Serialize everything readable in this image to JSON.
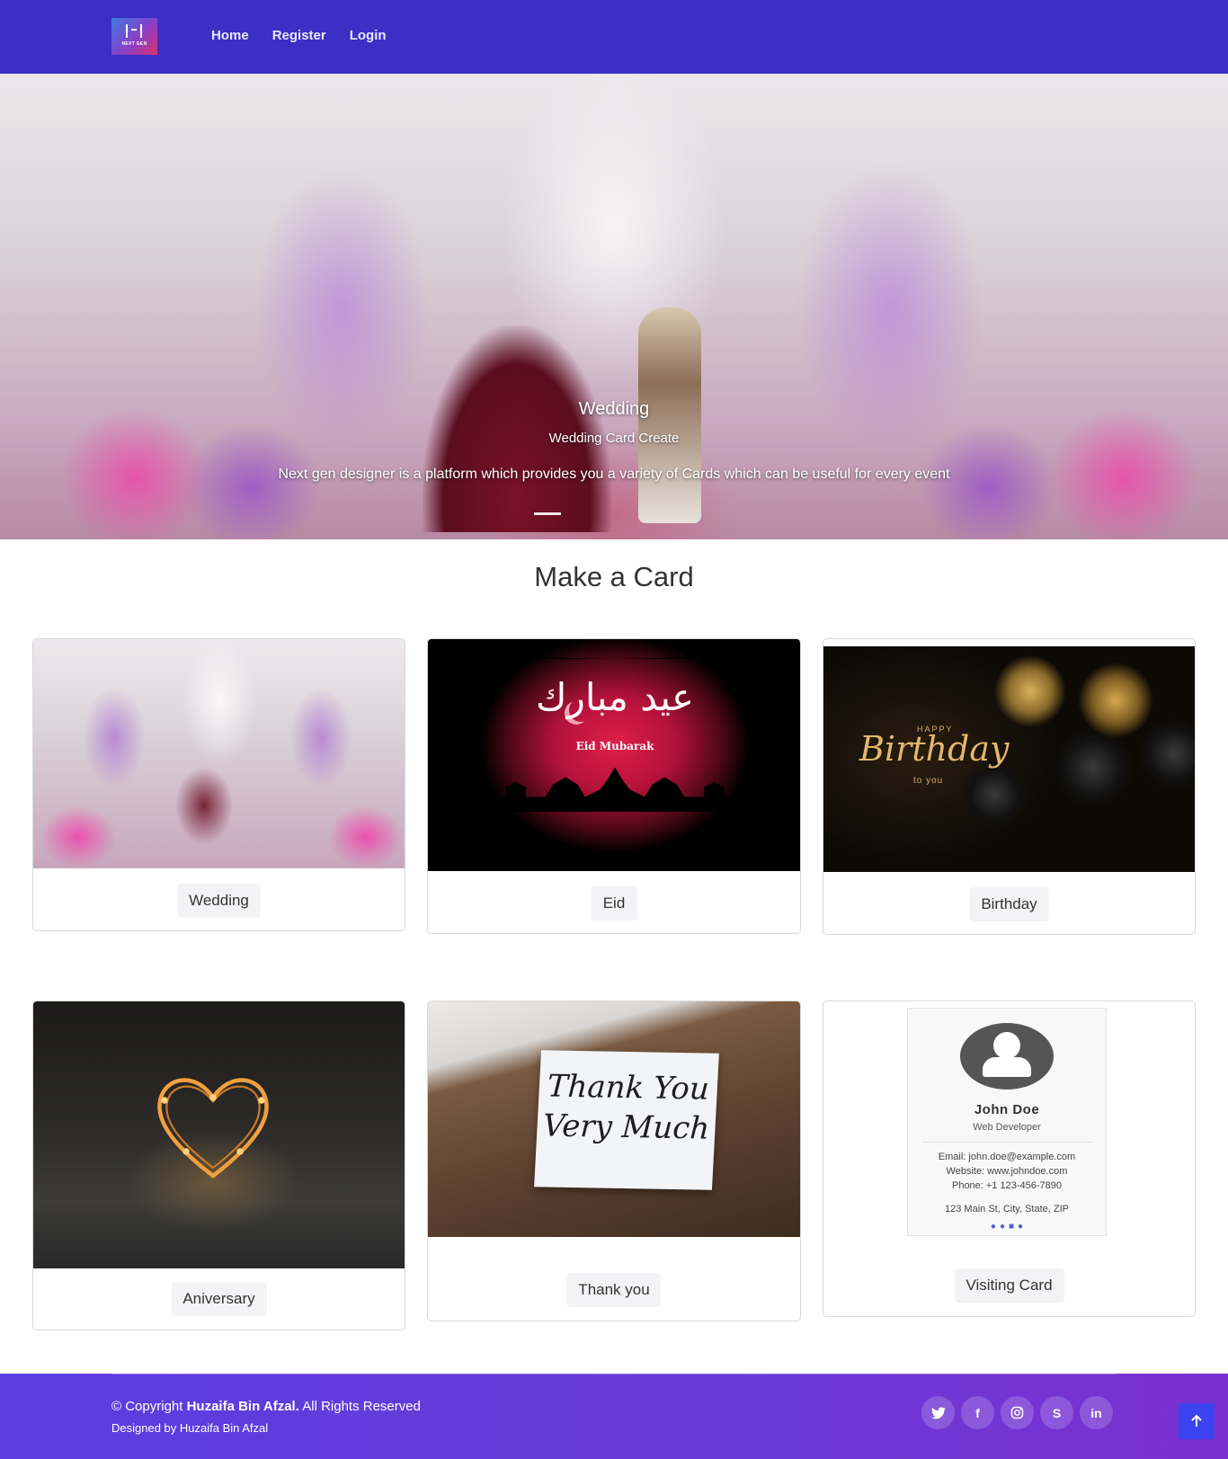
{
  "header": {
    "logo_text": "NEXT GEN",
    "nav": [
      "Home",
      "Register",
      "Login"
    ]
  },
  "hero": {
    "title": "Wedding",
    "subtitle": "Wedding Card Create",
    "text": "Next gen designer is a platform which provides you a variety of Cards which can be useful for every event"
  },
  "section": {
    "title": "Make a Card"
  },
  "cards": [
    {
      "label": "Wedding",
      "image": "wedding-photo"
    },
    {
      "label": "Eid",
      "image": "eid-mubarak-art",
      "image_text": "Eid Mubarak",
      "image_script": "عيد مبارك"
    },
    {
      "label": "Birthday",
      "image": "birthday-balloons",
      "image_small": "HAPPY",
      "image_main": "Birthday",
      "image_to": "to you"
    },
    {
      "label": "Aniversary",
      "image": "heart-lights"
    },
    {
      "label": "Thank you",
      "image": "thank-you-note",
      "image_text_1": "Thank You",
      "image_text_2": "Very Much"
    },
    {
      "label": "Visiting Card",
      "image": "visiting-card-sample"
    }
  ],
  "visiting_card": {
    "name": "John Doe",
    "role": "Web Developer",
    "email": "Email: john.doe@example.com",
    "website": "Website: www.johndoe.com",
    "phone": "Phone: +1 123-456-7890",
    "address": "123 Main St, City, State, ZIP"
  },
  "footer": {
    "copyright_prefix": "© Copyright",
    "copyright_name": "Huzaifa Bin Afzal.",
    "copyright_suffix": "All Rights Reserved",
    "designed_by": "Designed by Huzaifa Bin Afzal",
    "socials": [
      "twitter-icon",
      "facebook-icon",
      "instagram-icon",
      "skype-icon",
      "linkedin-icon"
    ]
  },
  "colors": {
    "header": "#3b2fc6",
    "footer": "#5b3de0",
    "to_top": "#3b44f0"
  }
}
